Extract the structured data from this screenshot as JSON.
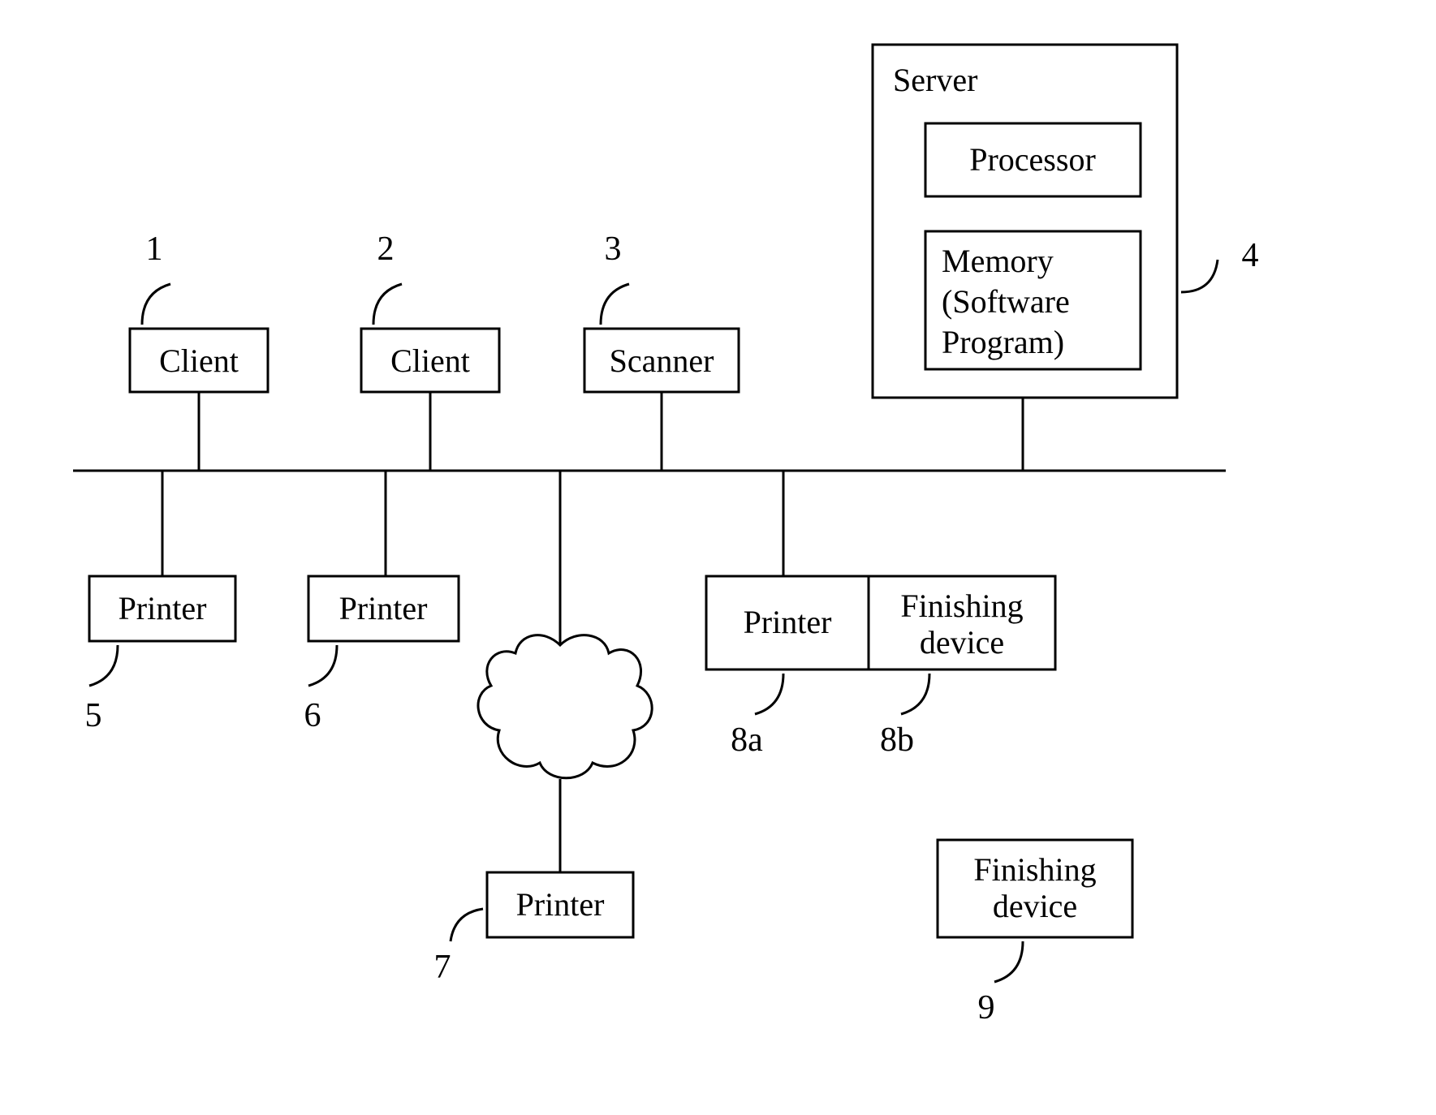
{
  "nodes": {
    "client1": {
      "label": "Client",
      "ref": "1"
    },
    "client2": {
      "label": "Client",
      "ref": "2"
    },
    "scanner": {
      "label": "Scanner",
      "ref": "3"
    },
    "server": {
      "label": "Server",
      "ref": "4"
    },
    "processor": {
      "label": "Processor"
    },
    "memory": {
      "line1": "Memory",
      "line2": "(Software",
      "line3": "Program)"
    },
    "printer5": {
      "label": "Printer",
      "ref": "5"
    },
    "printer6": {
      "label": "Printer",
      "ref": "6"
    },
    "printer7": {
      "label": "Printer",
      "ref": "7"
    },
    "printer8a": {
      "label": "Printer",
      "ref": "8a"
    },
    "fin8b": {
      "line1": "Finishing",
      "line2": "device",
      "ref": "8b"
    },
    "fin9": {
      "line1": "Finishing",
      "line2": "device",
      "ref": "9"
    },
    "cloud": {
      "name": "cloud-network"
    }
  }
}
